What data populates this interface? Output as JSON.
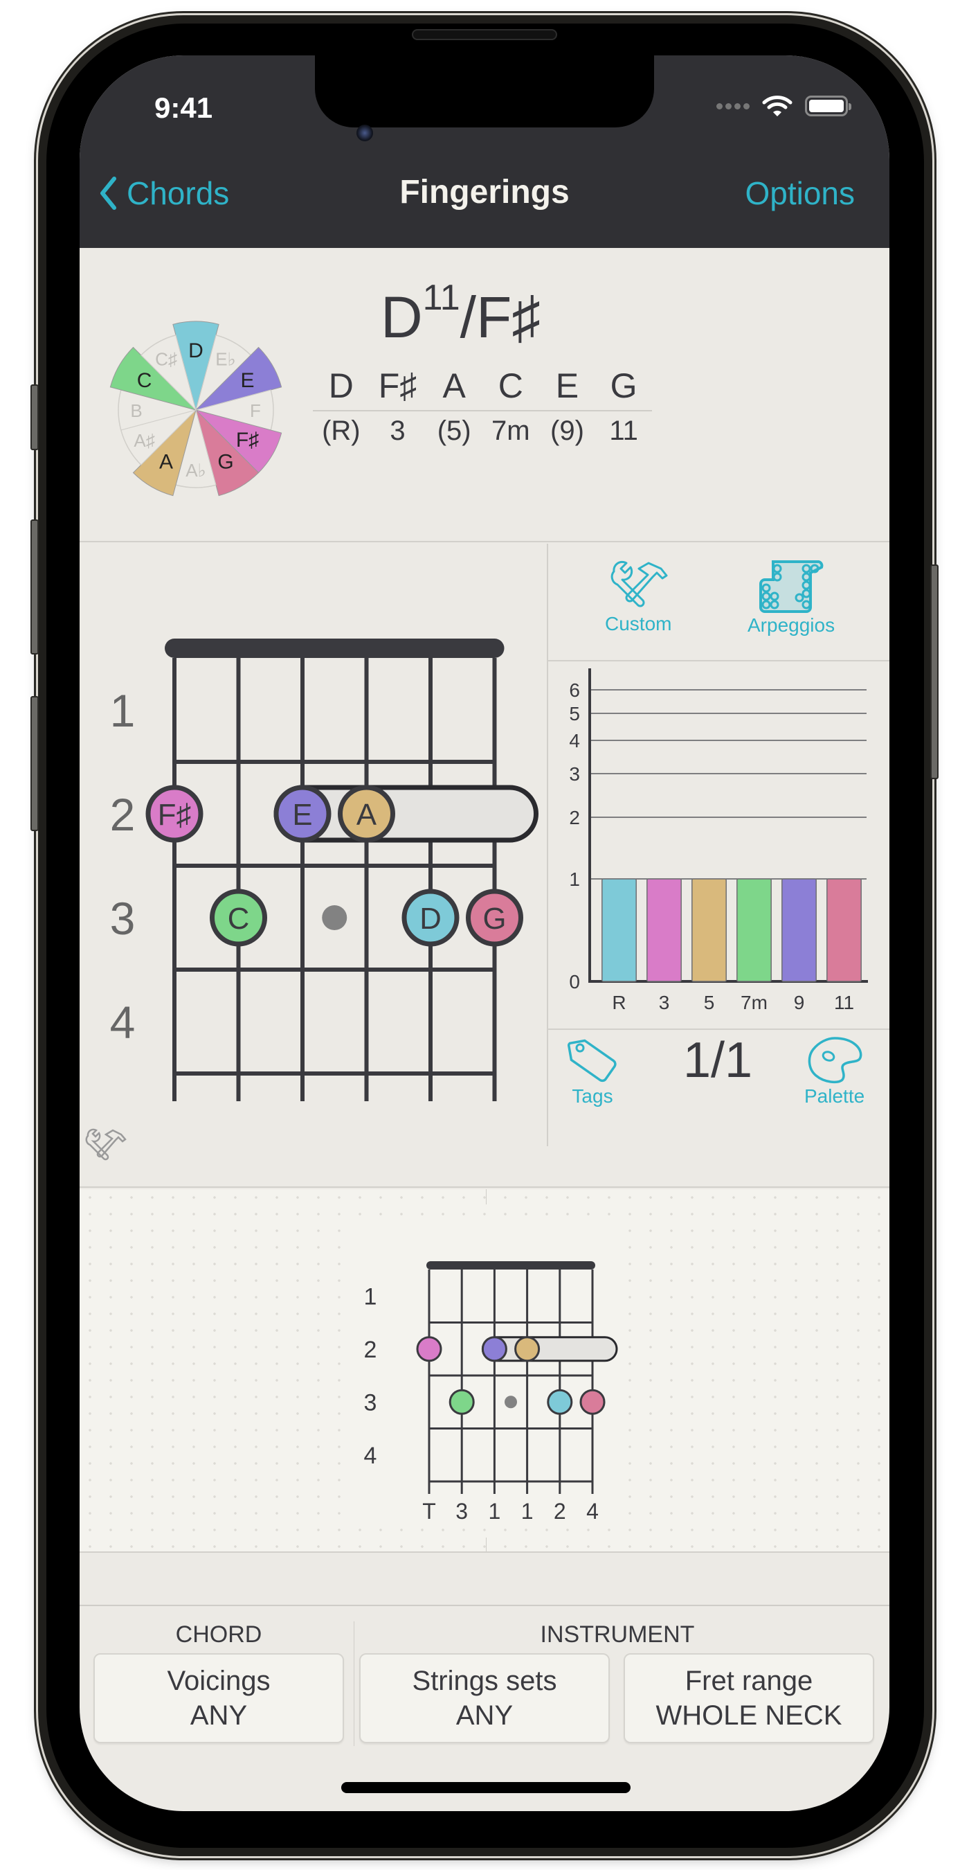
{
  "status_bar": {
    "time": "9:41"
  },
  "nav": {
    "back_label": "Chords",
    "title": "Fingerings",
    "options_label": "Options"
  },
  "chord": {
    "root": "D",
    "extension": "11",
    "bass": "/F♯",
    "notes": [
      "D",
      "F♯",
      "A",
      "C",
      "E",
      "G"
    ],
    "intervals": [
      "(R)",
      "3",
      "(5)",
      "7m",
      "(9)",
      "11"
    ]
  },
  "note_colors": {
    "D": "#7ECAD8",
    "F♯": "#D97CC8",
    "A": "#D9B97C",
    "C": "#7ED68A",
    "E": "#8C7FD6",
    "G": "#D97C9A"
  },
  "wheel": {
    "segments": [
      {
        "label": "D",
        "active": true
      },
      {
        "label": "E♭",
        "active": false
      },
      {
        "label": "E",
        "active": true
      },
      {
        "label": "F",
        "active": false
      },
      {
        "label": "F♯",
        "active": true
      },
      {
        "label": "G",
        "active": true
      },
      {
        "label": "A♭",
        "active": false
      },
      {
        "label": "A",
        "active": true
      },
      {
        "label": "A♯",
        "active": false
      },
      {
        "label": "B",
        "active": false
      },
      {
        "label": "C",
        "active": true
      },
      {
        "label": "C♯",
        "active": false
      }
    ]
  },
  "fretboard": {
    "fret_labels": [
      "1",
      "2",
      "3",
      "4"
    ],
    "dots": [
      {
        "string": 1,
        "fret": 2,
        "note": "F♯"
      },
      {
        "string": 2,
        "fret": 3,
        "note": "C"
      },
      {
        "string": 3,
        "fret": 2,
        "note": "E"
      },
      {
        "string": 4,
        "fret": 2,
        "note": "A"
      },
      {
        "string": 5,
        "fret": 3,
        "note": "D"
      },
      {
        "string": 6,
        "fret": 3,
        "note": "G"
      }
    ],
    "barre": {
      "fret": 2,
      "from_string": 3,
      "to_string": 6
    },
    "marker_fret": 3,
    "fingers": [
      "T",
      "3",
      "1",
      "1",
      "2",
      "4"
    ]
  },
  "side_panel": {
    "custom_label": "Custom",
    "arpeggios_label": "Arpeggios",
    "tags_label": "Tags",
    "palette_label": "Palette",
    "page_count": "1/1"
  },
  "chart_data": {
    "type": "bar",
    "title": "",
    "xlabel": "",
    "ylabel": "",
    "categories": [
      "R",
      "3",
      "5",
      "7m",
      "9",
      "11"
    ],
    "values": [
      1,
      1,
      1,
      1,
      1,
      1
    ],
    "colors": [
      "#7ECAD8",
      "#D97CC8",
      "#D9B97C",
      "#7ED68A",
      "#8C7FD6",
      "#D97C9A"
    ],
    "yticks": [
      0,
      1,
      2,
      3,
      4,
      5,
      6
    ],
    "ylim": [
      0,
      6
    ],
    "yscale": "log-like",
    "grid": true
  },
  "filters": {
    "chord_group_label": "CHORD",
    "instrument_group_label": "INSTRUMENT",
    "buttons": [
      {
        "title": "Voicings",
        "value": "ANY"
      },
      {
        "title": "Strings sets",
        "value": "ANY"
      },
      {
        "title": "Fret range",
        "value": "WHOLE NECK"
      }
    ]
  }
}
